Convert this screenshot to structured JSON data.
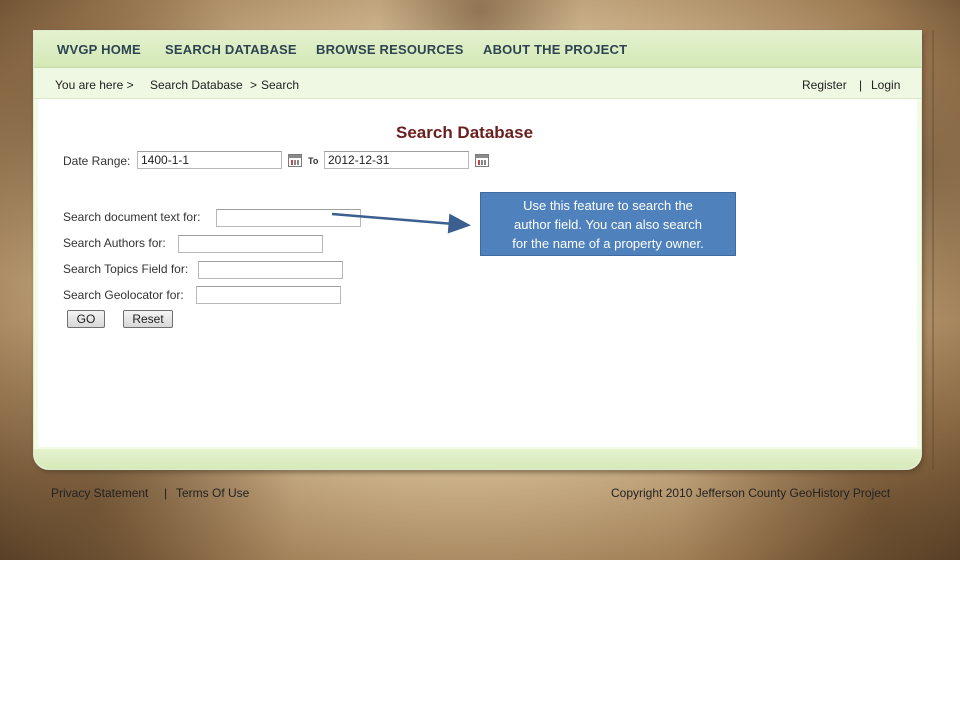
{
  "nav": {
    "home": "WVGP HOME",
    "search": "SEARCH DATABASE",
    "browse": "BROWSE RESOURCES",
    "about": "ABOUT THE PROJECT"
  },
  "breadcrumb": {
    "prefix": "You are here  >",
    "section": "Search Database",
    "separator": ">",
    "current": "Search"
  },
  "account": {
    "register": "Register",
    "divider": "|",
    "login": "Login"
  },
  "page_title": "Search Database",
  "form": {
    "date_range_label": "Date Range:",
    "date_from": "1400-1-1",
    "to_label": "To",
    "date_to": "2012-12-31",
    "doc_text_label": "Search document text for:",
    "doc_text_value": "",
    "authors_label": "Search Authors for:",
    "authors_value": "",
    "topics_label": "Search Topics Field for:",
    "topics_value": "",
    "geolocator_label": "Search Geolocator for:",
    "geolocator_value": "",
    "go_label": "GO",
    "reset_label": "Reset"
  },
  "callout": {
    "line1": "Use this feature to search the",
    "line2": "author  field.  You can also search",
    "line3": "for the name of a property owner."
  },
  "footer": {
    "privacy": "Privacy Statement",
    "divider": "|",
    "terms": "Terms Of Use",
    "copyright": "Copyright 2010 Jefferson County GeoHistory Project"
  },
  "colors": {
    "nav_text": "#2e4450",
    "title": "#6a1f1f",
    "callout_bg": "#4f81bd",
    "panel_bg": "#f2fbe6"
  }
}
